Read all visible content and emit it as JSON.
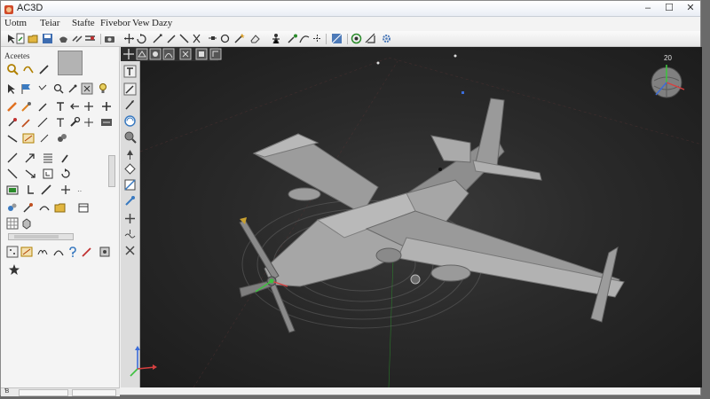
{
  "window": {
    "title": "AC3D"
  },
  "menu": [
    "Uotm",
    "Teiar",
    "Stafte",
    "Fivebor",
    "Vew",
    "Dazy"
  ],
  "window_controls": [
    "–",
    "☐",
    "✕"
  ],
  "left_panel": {
    "header": "Aceetes"
  },
  "status": {
    "text": "Ɓ"
  },
  "viewport": {
    "nav_label": "20"
  },
  "colors": {
    "axis_x": "#d64040",
    "axis_y": "#3ec040",
    "axis_z": "#3b6cd8",
    "model": "#a0a0a0"
  }
}
